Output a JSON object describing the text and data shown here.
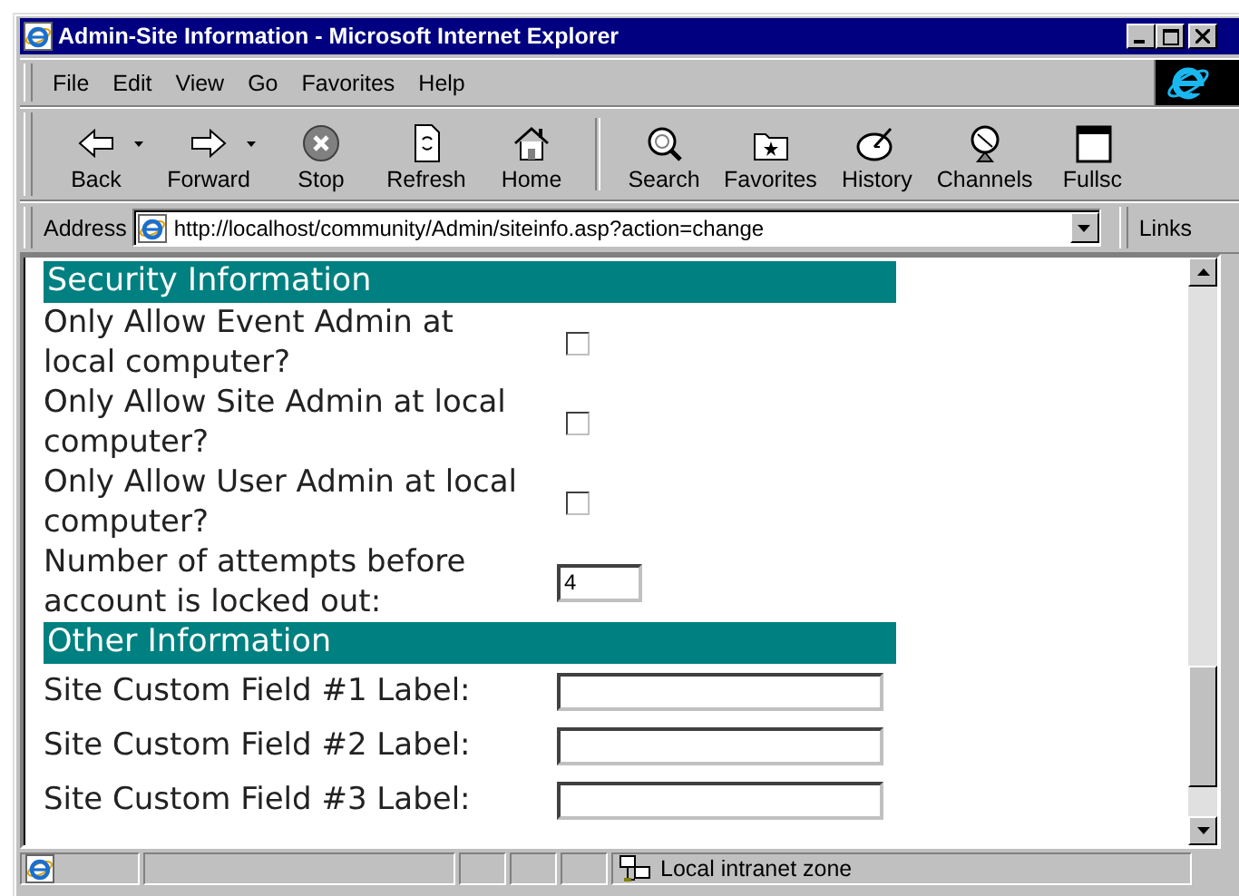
{
  "window": {
    "title": "Admin-Site Information - Microsoft Internet Explorer"
  },
  "menu": [
    {
      "label": "File"
    },
    {
      "label": "Edit"
    },
    {
      "label": "View"
    },
    {
      "label": "Go"
    },
    {
      "label": "Favorites"
    },
    {
      "label": "Help"
    }
  ],
  "toolbar": [
    {
      "kind": "back",
      "label": "Back",
      "dropdown": true
    },
    {
      "kind": "forward",
      "label": "Forward",
      "dropdown": true
    },
    {
      "kind": "stop",
      "label": "Stop",
      "dropdown": false
    },
    {
      "kind": "refresh",
      "label": "Refresh",
      "dropdown": false
    },
    {
      "kind": "home",
      "label": "Home",
      "dropdown": false
    },
    {
      "kind": "separator"
    },
    {
      "kind": "search",
      "label": "Search",
      "dropdown": false
    },
    {
      "kind": "favorites",
      "label": "Favorites",
      "dropdown": false
    },
    {
      "kind": "history",
      "label": "History",
      "dropdown": false
    },
    {
      "kind": "channels",
      "label": "Channels",
      "dropdown": false
    },
    {
      "kind": "fullscreen",
      "label": "Fullsc",
      "dropdown": false
    }
  ],
  "address": {
    "label": "Address",
    "value": "http://localhost/community/Admin/siteinfo.asp?action=change",
    "links": "Links"
  },
  "sections": [
    {
      "title": "Security Information",
      "rows": [
        {
          "kind": "checkbox",
          "label": "Only Allow Event Admin at local computer?",
          "checked": false
        },
        {
          "kind": "checkbox",
          "label": "Only Allow Site Admin at local computer?",
          "checked": false
        },
        {
          "kind": "checkbox",
          "label": "Only Allow User Admin at local computer?",
          "checked": false
        },
        {
          "kind": "number",
          "label": "Number of attempts before account is locked out:",
          "value": "4"
        }
      ]
    },
    {
      "title": "Other Information",
      "rows": [
        {
          "kind": "text",
          "label": "Site Custom Field #1 Label:"
        },
        {
          "kind": "text",
          "label": "Site Custom Field #2 Label:"
        },
        {
          "kind": "text",
          "label": "Site Custom Field #3 Label:"
        }
      ]
    }
  ],
  "status_bar": {
    "zone": "Local intranet zone"
  }
}
